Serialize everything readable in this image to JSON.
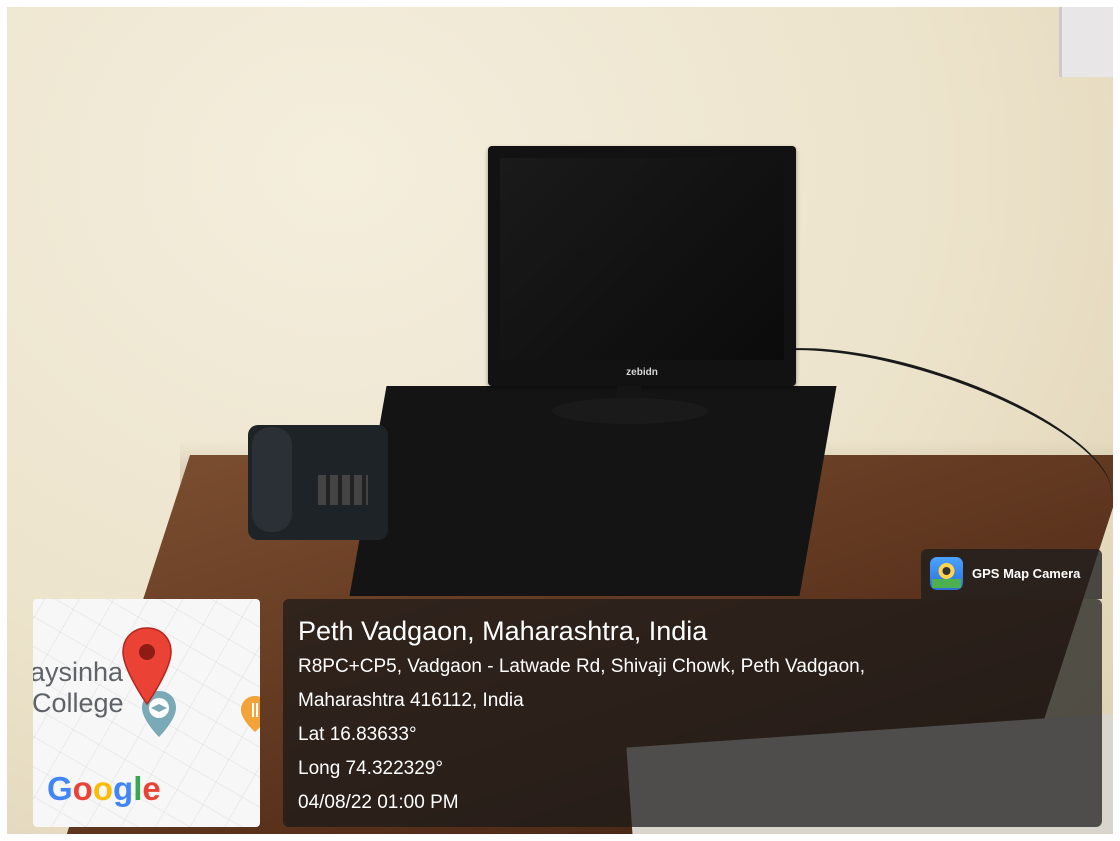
{
  "photo": {
    "monitor_brand": "zebidn"
  },
  "map_card": {
    "place_text_line1": "aysinha",
    "place_text_line2": "College",
    "logo_letters": [
      "G",
      "o",
      "o",
      "g",
      "l",
      "e"
    ],
    "logo_colors": [
      "#4285F4",
      "#EA4335",
      "#FBBC05",
      "#4285F4",
      "#34A853",
      "#EA4335"
    ],
    "pin_color": "#EA4335",
    "education_icon": "school-place-icon",
    "food_icon": "restaurant-place-icon"
  },
  "app_badge": {
    "icon": "gps-map-camera-app-icon",
    "name": "GPS Map Camera"
  },
  "location": {
    "title": "Peth Vadgaon, Maharashtra, India",
    "address_line1": "R8PC+CP5, Vadgaon - Latwade Rd, Shivaji Chowk, Peth Vadgaon,",
    "address_line2": "Maharashtra 416112, India",
    "lat": "Lat 16.83633°",
    "long": "Long 74.322329°",
    "datetime": "04/08/22 01:00 PM"
  }
}
